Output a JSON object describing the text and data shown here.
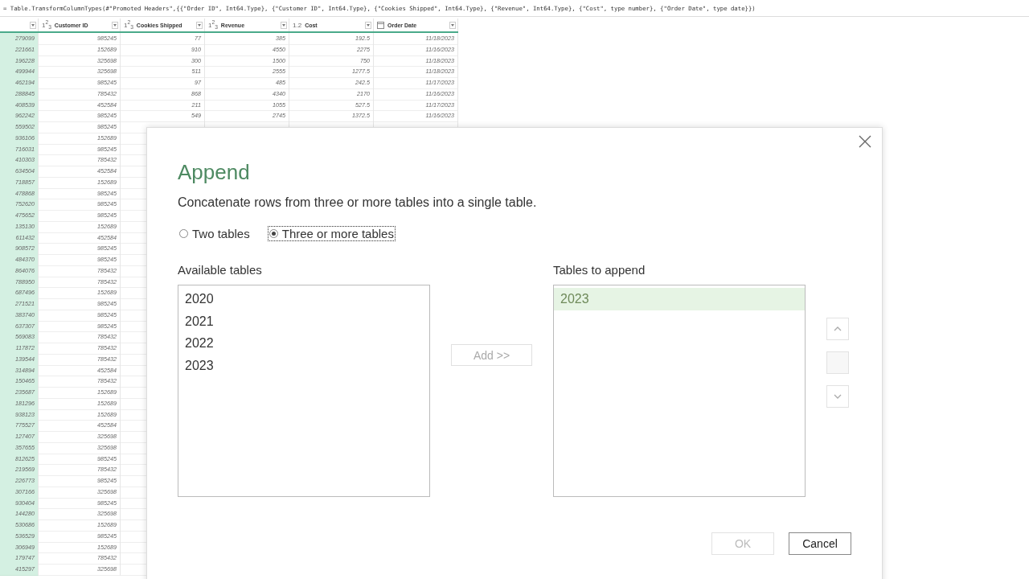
{
  "formula_bar": {
    "text": "= Table.TransformColumnTypes(#\"Promoted Headers\",{{\"Order ID\", Int64.Type}, {\"Customer ID\", Int64.Type}, {\"Cookies Shipped\", Int64.Type}, {\"Revenue\", Int64.Type}, {\"Cost\", type number}, {\"Order Date\", type date}})"
  },
  "table": {
    "columns": [
      {
        "kind": "key"
      },
      {
        "kind": "number",
        "type_label": "1$^{2}$$_{3}$",
        "name": "Customer ID"
      },
      {
        "kind": "number",
        "type_label": "1$^{2}$$_{3}$",
        "name": "Cookies Shipped"
      },
      {
        "kind": "number",
        "type_label": "1$^{2}$$_{3}$",
        "name": "Revenue"
      },
      {
        "kind": "number",
        "type_label": "1.2",
        "name": "Cost"
      },
      {
        "kind": "date",
        "name": "Order Date"
      }
    ],
    "rows": [
      [
        "279099",
        "985245",
        "77",
        "385",
        "192.5",
        "11/18/2023"
      ],
      [
        "221661",
        "152689",
        "910",
        "4550",
        "2275",
        "11/16/2023"
      ],
      [
        "196228",
        "325698",
        "300",
        "1500",
        "750",
        "11/18/2023"
      ],
      [
        "499944",
        "325698",
        "511",
        "2555",
        "1277.5",
        "11/18/2023"
      ],
      [
        "462194",
        "985245",
        "97",
        "485",
        "242.5",
        "11/17/2023"
      ],
      [
        "288845",
        "785432",
        "868",
        "4340",
        "2170",
        "11/16/2023"
      ],
      [
        "408539",
        "452584",
        "211",
        "1055",
        "527.5",
        "11/17/2023"
      ],
      [
        "962242",
        "985245",
        "549",
        "2745",
        "1372.5",
        "11/16/2023"
      ],
      [
        "559502",
        "985245"
      ],
      [
        "936106",
        "152689"
      ],
      [
        "716031",
        "985245"
      ],
      [
        "410303",
        "785432"
      ],
      [
        "634504",
        "452584"
      ],
      [
        "718857",
        "152689"
      ],
      [
        "478868",
        "985245"
      ],
      [
        "752620",
        "985245"
      ],
      [
        "475652",
        "985245"
      ],
      [
        "135130",
        "152689"
      ],
      [
        "611432",
        "452584"
      ],
      [
        "908572",
        "985245"
      ],
      [
        "484370",
        "985245"
      ],
      [
        "864076",
        "785432"
      ],
      [
        "788950",
        "785432"
      ],
      [
        "687496",
        "152689"
      ],
      [
        "271521",
        "985245"
      ],
      [
        "383740",
        "985245"
      ],
      [
        "637307",
        "985245"
      ],
      [
        "569083",
        "785432"
      ],
      [
        "117872",
        "785432"
      ],
      [
        "139544",
        "785432"
      ],
      [
        "314894",
        "452584"
      ],
      [
        "150465",
        "785432"
      ],
      [
        "235687",
        "152689"
      ],
      [
        "181296",
        "152689"
      ],
      [
        "938123",
        "152689"
      ],
      [
        "775527",
        "452584"
      ],
      [
        "127407",
        "325698"
      ],
      [
        "357655",
        "325698"
      ],
      [
        "812625",
        "985245"
      ],
      [
        "219569",
        "785432"
      ],
      [
        "226773",
        "985245"
      ],
      [
        "307166",
        "325698"
      ],
      [
        "930404",
        "985245"
      ],
      [
        "144280",
        "325698"
      ],
      [
        "530686",
        "152689"
      ],
      [
        "536529",
        "985245"
      ],
      [
        "306949",
        "152689"
      ],
      [
        "179747",
        "785432"
      ],
      [
        "415297",
        "325698"
      ]
    ]
  },
  "dialog": {
    "title": "Append",
    "description": "Concatenate rows from three or more tables into a single table.",
    "radios": [
      {
        "label": "Two tables",
        "selected": false,
        "focused": false
      },
      {
        "label": "Three or more tables",
        "selected": true,
        "focused": true
      }
    ],
    "available_label": "Available tables",
    "available_items": [
      {
        "label": "2020",
        "selected": false
      },
      {
        "label": "2021",
        "selected": false
      },
      {
        "label": "2022",
        "selected": false
      },
      {
        "label": "2023",
        "selected": false
      }
    ],
    "add_button": {
      "label": "Add >>",
      "disabled": true
    },
    "append_label": "Tables to append",
    "append_items": [
      {
        "label": "2023",
        "selected": true
      }
    ],
    "reorder_buttons": [
      {
        "kind": "up",
        "disabled": true
      },
      {
        "kind": "remove",
        "disabled": true
      },
      {
        "kind": "down",
        "disabled": true
      }
    ],
    "buttons": [
      {
        "label": "OK",
        "disabled": true
      },
      {
        "label": "Cancel",
        "disabled": false
      }
    ]
  }
}
